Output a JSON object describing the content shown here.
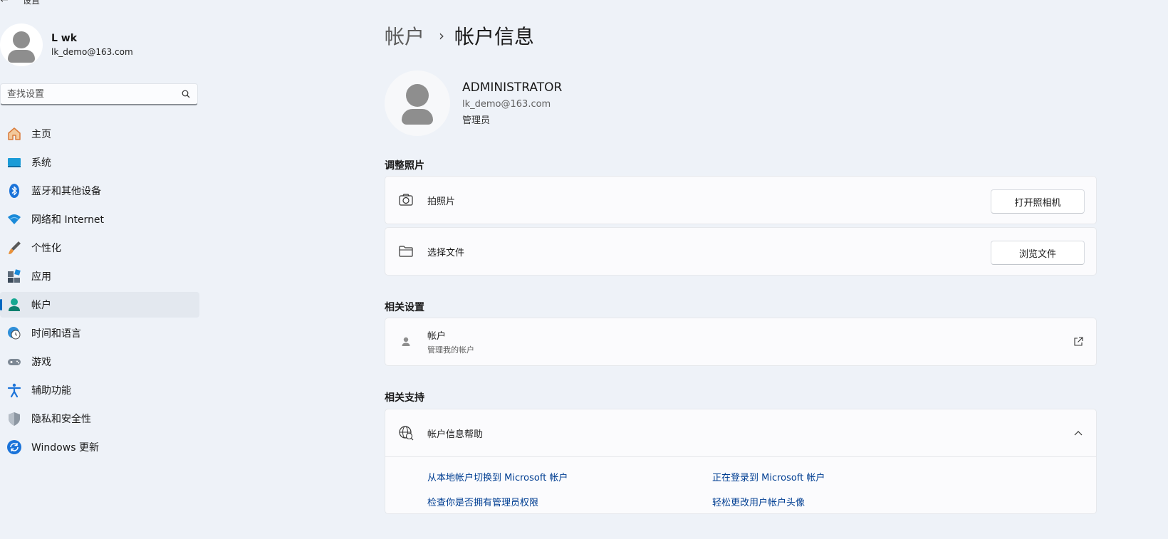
{
  "window": {
    "title": "设置"
  },
  "user": {
    "name": "L wk",
    "email": "lk_demo@163.com"
  },
  "search": {
    "placeholder": "查找设置"
  },
  "nav": {
    "items": [
      {
        "label": "主页",
        "icon": "home-icon"
      },
      {
        "label": "系统",
        "icon": "system-icon"
      },
      {
        "label": "蓝牙和其他设备",
        "icon": "bluetooth-icon"
      },
      {
        "label": "网络和 Internet",
        "icon": "wifi-icon"
      },
      {
        "label": "个性化",
        "icon": "brush-icon"
      },
      {
        "label": "应用",
        "icon": "apps-icon"
      },
      {
        "label": "帐户",
        "icon": "account-icon",
        "active": true
      },
      {
        "label": "时间和语言",
        "icon": "time-language-icon"
      },
      {
        "label": "游戏",
        "icon": "gamepad-icon"
      },
      {
        "label": "辅助功能",
        "icon": "accessibility-icon"
      },
      {
        "label": "隐私和安全性",
        "icon": "shield-icon"
      },
      {
        "label": "Windows 更新",
        "icon": "update-icon"
      }
    ]
  },
  "breadcrumb": {
    "parent": "帐户",
    "separator": "›",
    "current": "帐户信息"
  },
  "account": {
    "name": "ADMINISTRATOR",
    "email": "lk_demo@163.com",
    "role": "管理员"
  },
  "photo": {
    "section_title": "调整照片",
    "take_photo_label": "拍照片",
    "take_photo_button": "打开照相机",
    "choose_file_label": "选择文件",
    "choose_file_button": "浏览文件"
  },
  "related_settings": {
    "section_title": "相关设置",
    "title": "帐户",
    "subtitle": "管理我的帐户"
  },
  "related_support": {
    "section_title": "相关支持",
    "title": "帐户信息帮助",
    "links": [
      "从本地帐户切换到 Microsoft 帐户",
      "正在登录到 Microsoft 帐户",
      "检查你是否拥有管理员权限",
      "轻松更改用户帐户头像"
    ]
  },
  "colors": {
    "accent": "#0067c0",
    "link": "#003e92",
    "background": "#eef2f8"
  }
}
